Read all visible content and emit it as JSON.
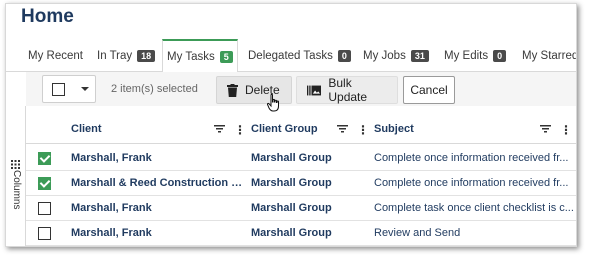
{
  "page": {
    "title": "Home"
  },
  "tabs": [
    {
      "label": "My Recent",
      "badge": ""
    },
    {
      "label": "In Tray",
      "badge": "18"
    },
    {
      "label": "My Tasks",
      "badge": "5"
    },
    {
      "label": "Delegated Tasks",
      "badge": "0"
    },
    {
      "label": "My Jobs",
      "badge": "31"
    },
    {
      "label": "My Edits",
      "badge": "0"
    },
    {
      "label": "My Starred",
      "badge": ""
    }
  ],
  "active_tab": "My Tasks",
  "toolbar": {
    "selected_text": "2 item(s) selected",
    "delete_label": "Delete",
    "bulk_update_label": "Bulk Update",
    "cancel_label": "Cancel"
  },
  "side_panel": {
    "label": "Columns"
  },
  "table": {
    "columns": [
      "Client",
      "Client Group",
      "Subject"
    ],
    "rows": [
      {
        "checked": true,
        "client": "Marshall, Frank",
        "group": "Marshall Group",
        "subject": "Complete once information received fr..."
      },
      {
        "checked": true,
        "client": "Marshall & Reed Construction Ltd",
        "group": "Marshall Group",
        "subject": "Complete once information received fr..."
      },
      {
        "checked": false,
        "client": "Marshall, Frank",
        "group": "Marshall Group",
        "subject": "Complete task once client checklist is c..."
      },
      {
        "checked": false,
        "client": "Marshall, Frank",
        "group": "Marshall Group",
        "subject": "Review and Send"
      }
    ]
  },
  "colors": {
    "accent": "#3c9b57",
    "heading": "#1f3a5f",
    "badge_dark": "#4a4a4a"
  }
}
